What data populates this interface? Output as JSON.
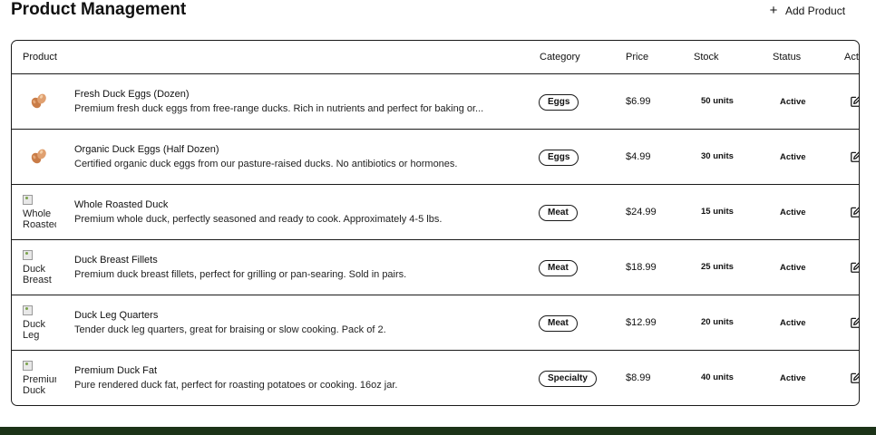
{
  "header": {
    "title": "Product Management",
    "add_icon": "plus-icon",
    "add_label": "Add Product"
  },
  "table": {
    "columns": {
      "product": "Product",
      "category": "Category",
      "price": "Price",
      "stock": "Stock",
      "status": "Status",
      "actions": "Actions"
    },
    "rows": [
      {
        "thumb": "duck-eggs-image",
        "name": "Fresh Duck Eggs (Dozen)",
        "description": "Premium fresh duck eggs from free-range ducks. Rich in nutrients and perfect for baking or...",
        "category": "Eggs",
        "price": "$6.99",
        "stock": "50 units",
        "status": "Active"
      },
      {
        "thumb": "duck-eggs-image",
        "name": "Organic Duck Eggs (Half Dozen)",
        "description": "Certified organic duck eggs from our pasture-raised ducks. No antibiotics or hormones.",
        "category": "Eggs",
        "price": "$4.99",
        "stock": "30 units",
        "status": "Active"
      },
      {
        "thumb_alt": "Whole Roasted",
        "name": "Whole Roasted Duck",
        "description": "Premium whole duck, perfectly seasoned and ready to cook. Approximately 4-5 lbs.",
        "category": "Meat",
        "price": "$24.99",
        "stock": "15 units",
        "status": "Active"
      },
      {
        "thumb_alt": "Duck Breast",
        "name": "Duck Breast Fillets",
        "description": "Premium duck breast fillets, perfect for grilling or pan-searing. Sold in pairs.",
        "category": "Meat",
        "price": "$18.99",
        "stock": "25 units",
        "status": "Active"
      },
      {
        "thumb_alt": "Duck Leg",
        "name": "Duck Leg Quarters",
        "description": "Tender duck leg quarters, great for braising or slow cooking. Pack of 2.",
        "category": "Meat",
        "price": "$12.99",
        "stock": "20 units",
        "status": "Active"
      },
      {
        "thumb_alt": "Premium Duck",
        "name": "Premium Duck Fat",
        "description": "Pure rendered duck fat, perfect for roasting potatoes or cooking. 16oz jar.",
        "category": "Specialty",
        "price": "$8.99",
        "stock": "40 units",
        "status": "Active"
      }
    ],
    "action_icons": [
      "edit-icon",
      "trash-icon"
    ]
  },
  "colors": {
    "border": "#1a1a1a",
    "footer": "#1c3318",
    "egg": "#d08a55"
  }
}
